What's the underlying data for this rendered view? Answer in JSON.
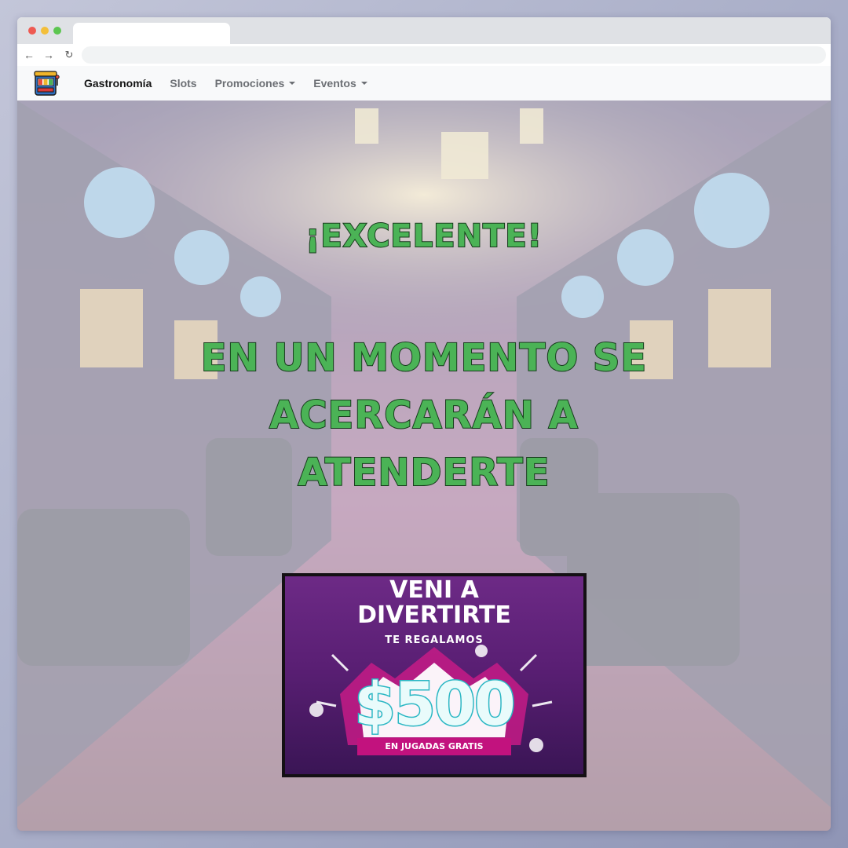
{
  "navbar": {
    "items": [
      {
        "label": "Gastronomía",
        "active": true,
        "dropdown": false
      },
      {
        "label": "Slots",
        "active": false,
        "dropdown": false
      },
      {
        "label": "Promociones",
        "active": false,
        "dropdown": true
      },
      {
        "label": "Eventos",
        "active": false,
        "dropdown": true
      }
    ]
  },
  "hero": {
    "headline_1": "¡Excelente!",
    "headline_2": "En un momento se acercarán a atenderte"
  },
  "promo": {
    "title_line_1": "VENI A",
    "title_line_2": "DIVERTIRTE",
    "subtitle": "TE REGALAMOS",
    "amount": "$500",
    "ribbon": "EN JUGADAS GRATIS"
  },
  "colors": {
    "headline": "#4bb356",
    "headline_outline": "#173a1c",
    "promo_bg": "#6d2a86",
    "ribbon": "#c2127e"
  },
  "icons": {
    "logo": "slot-machine-icon",
    "back": "arrow-left-icon",
    "forward": "arrow-right-icon",
    "reload": "reload-icon"
  }
}
